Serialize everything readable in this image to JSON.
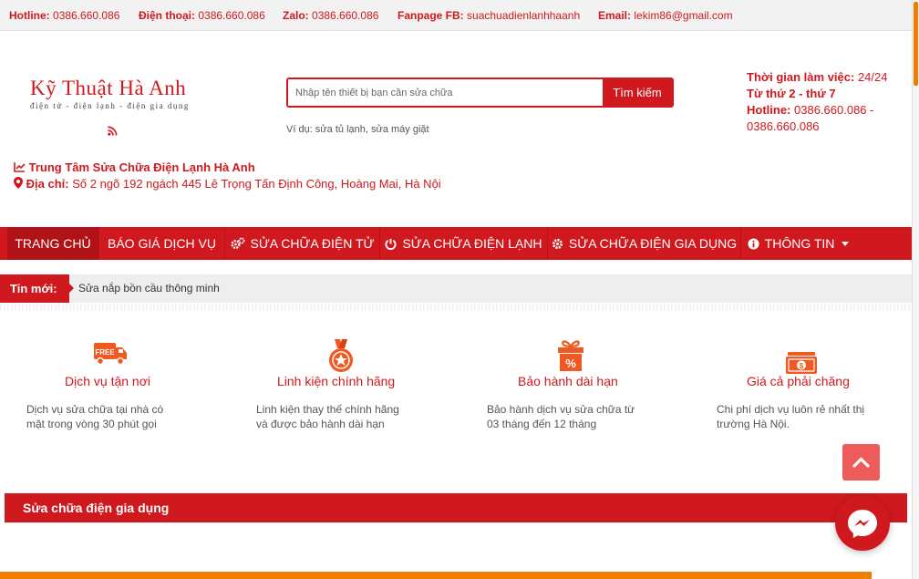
{
  "topbar": {
    "items": [
      {
        "label": "Hotline:",
        "value": "0386.660.086"
      },
      {
        "label": "Điện thoại:",
        "value": "0386.660.086"
      },
      {
        "label": "Zalo:",
        "value": "0386.660.086"
      },
      {
        "label": "Fanpage FB:",
        "value": "suachuadienlanhhaanh"
      },
      {
        "label": "Email:",
        "value": "lekim86@gmail.com"
      }
    ]
  },
  "logo": {
    "title": "Kỹ Thuật Hà Anh",
    "subtitle": "điện tử - điện lạnh - điện gia dụng",
    "rss_icon": "rss-icon"
  },
  "search": {
    "placeholder": "Nhập tên thiết bị bạn cần sửa chữa",
    "button_label": "Tìm kiếm",
    "hint": "Ví dụ: sửa tủ lạnh, sửa máy giặt"
  },
  "work_info": {
    "hours_label": "Thời gian làm việc:",
    "hours_value": "24/24",
    "days": "Từ thứ 2 - thứ 7",
    "hotline_label": "Hotline:",
    "hotline_value": "0386.660.086 -",
    "hotline_value2": "0386.660.086"
  },
  "center": {
    "name": "Trung Tâm Sửa Chữa Điện Lạnh Hà Anh",
    "address_label": "Địa chỉ:",
    "address": "Số 2 ngõ 192 ngách 445 Lê Trọng Tấn Định Công, Hoàng Mai, Hà Nội"
  },
  "nav": {
    "items": [
      {
        "label": "TRANG CHỦ",
        "icon": ""
      },
      {
        "label": "BÁO GIÁ DỊCH VỤ",
        "icon": ""
      },
      {
        "label": "SỬA CHỮA ĐIỆN TỬ",
        "icon": "gears-icon"
      },
      {
        "label": "SỬA CHỮA ĐIỆN LẠNH",
        "icon": "power-icon"
      },
      {
        "label": "SỬA CHỮA ĐIỆN GIA DỤNG",
        "icon": "gear-icon"
      },
      {
        "label": "THÔNG TIN",
        "icon": "info-icon"
      }
    ]
  },
  "ticker": {
    "label": "Tin mới:",
    "text": "Sửa nắp bồn cầu thông minh"
  },
  "features": [
    {
      "title": "Dịch vụ tận nơi",
      "desc1": "Dịch vụ sửa chữa tại nhà có",
      "desc2": "mặt trong vòng 30 phút gọi",
      "icon": "free-delivery-truck-icon"
    },
    {
      "title": "Linh kiện chính hãng",
      "desc1": "Linh kiện thay thế chính hãng",
      "desc2": "và được bảo hành dài hạn",
      "icon": "medal-icon"
    },
    {
      "title": "Bảo hành dài hạn",
      "desc1": "Bảo hành dịch vụ sửa chữa từ",
      "desc2": "03 tháng đến 12 tháng",
      "icon": "gift-percent-icon"
    },
    {
      "title": "Giá cả phải chăng",
      "desc1": "Chi phí dịch vụ luôn rẻ nhất thị",
      "desc2": "trường Hà Nội.",
      "icon": "money-icon"
    }
  ],
  "section": {
    "title": "Sửa chữa điện gia dụng"
  },
  "colors": {
    "brand_red": "#d0191e",
    "accent_orange": "#ef7d00"
  }
}
